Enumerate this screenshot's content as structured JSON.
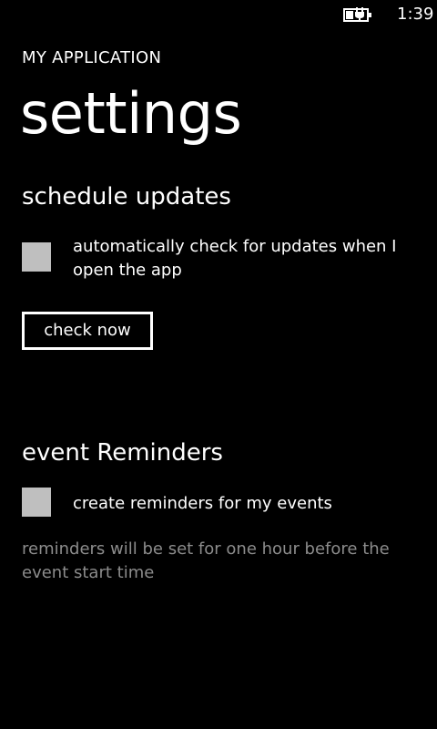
{
  "status_bar": {
    "time": "1:39",
    "battery_icon": "battery-charging-icon"
  },
  "header": {
    "app_title": "MY APPLICATION",
    "page_title": "settings"
  },
  "schedule_updates": {
    "title": "schedule updates",
    "auto_check_label": "automatically check for updates when I open the app",
    "auto_check_checked": false,
    "check_now_label": "check now"
  },
  "event_reminders": {
    "title": "event Reminders",
    "create_reminders_label": "create reminders for my events",
    "create_reminders_checked": false,
    "note": "reminders will be set for one hour before the event start time"
  },
  "colors": {
    "background": "#000000",
    "text": "#ffffff",
    "checkbox": "#bfbfbf",
    "secondary_text": "#8c8c8c"
  }
}
